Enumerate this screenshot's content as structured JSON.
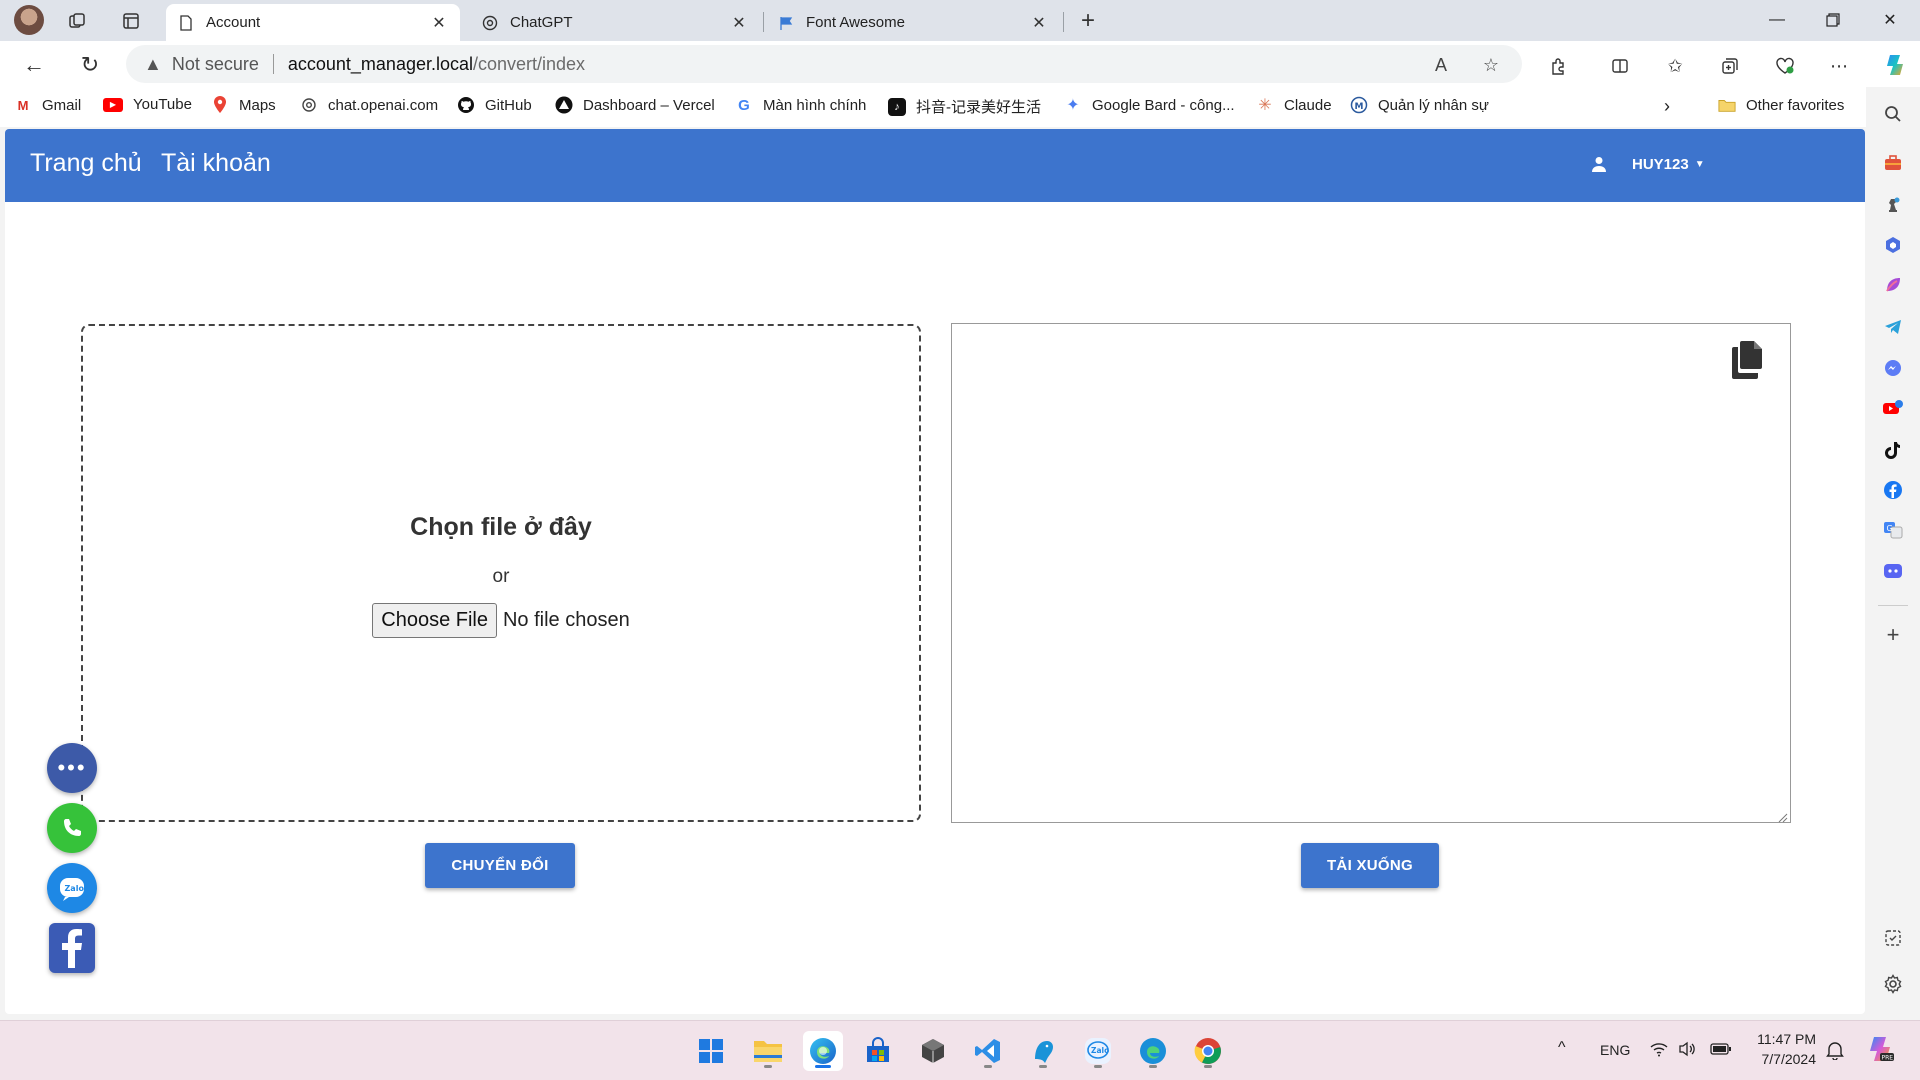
{
  "browser": {
    "tabs": [
      {
        "title": "Account",
        "icon": "page-icon",
        "active": true
      },
      {
        "title": "ChatGPT",
        "icon": "chatgpt-icon",
        "active": false
      },
      {
        "title": "Font Awesome",
        "icon": "font-awesome-flag-icon",
        "active": false
      }
    ],
    "address": {
      "security_label": "Not secure",
      "host": "account_manager.local",
      "path": "/convert/index"
    },
    "bookmarks": [
      {
        "label": "Gmail",
        "icon": "gmail-icon"
      },
      {
        "label": "YouTube",
        "icon": "youtube-icon"
      },
      {
        "label": "Maps",
        "icon": "maps-icon"
      },
      {
        "label": "chat.openai.com",
        "icon": "openai-icon"
      },
      {
        "label": "GitHub",
        "icon": "github-icon"
      },
      {
        "label": "Dashboard – Vercel",
        "icon": "vercel-icon"
      },
      {
        "label": "Màn hình chính",
        "icon": "google-icon"
      },
      {
        "label": "抖音-记录美好生活",
        "icon": "tiktok-icon"
      },
      {
        "label": "Google Bard - công...",
        "icon": "bard-icon"
      },
      {
        "label": "Claude",
        "icon": "claude-icon"
      },
      {
        "label": "Quản lý nhân sự",
        "icon": "app-icon"
      }
    ],
    "other_favorites": "Other favorites"
  },
  "app": {
    "nav": {
      "home": "Trang chủ",
      "account": "Tài khoản"
    },
    "user": {
      "name": "HUY123"
    },
    "upload": {
      "title": "Chọn file ở đây",
      "or": "or",
      "choose_label": "Choose File",
      "status": "No file chosen"
    },
    "output": {
      "text": ""
    },
    "buttons": {
      "convert": "CHUYỂN ĐỔI",
      "download": "TẢI XUỐNG"
    }
  },
  "taskbar": {
    "language": "ENG",
    "time": "11:47 PM",
    "date": "7/7/2024"
  },
  "colors": {
    "brand": "#3d74cd",
    "phone": "#36c23a",
    "zalo": "#1e88e5",
    "facebook": "#3b5bb5"
  }
}
